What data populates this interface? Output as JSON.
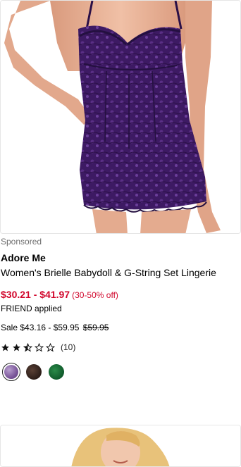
{
  "product": {
    "sponsored_label": "Sponsored",
    "brand": "Adore Me",
    "title": "Women's Brielle Babydoll & G-String Set Lingerie",
    "price_range": "$30.21 - $41.97",
    "discount": "(30-50% off)",
    "promo": "FRIEND applied",
    "sale_prefix": "Sale $43.16 - $59.95",
    "original_price": "$59.95",
    "rating_value": 2.5,
    "rating_max": 5,
    "review_count": "(10)",
    "swatches": [
      {
        "name": "purple-lace",
        "color": "#8e6ba8",
        "selected": true
      },
      {
        "name": "leopard",
        "color": "#3b2a24",
        "selected": false
      },
      {
        "name": "green",
        "color": "#0f5a2b",
        "selected": false
      }
    ]
  },
  "colors": {
    "sale_red": "#d1062b",
    "lingerie_purple": "#3d1a63",
    "skin": "#e8b39a"
  }
}
